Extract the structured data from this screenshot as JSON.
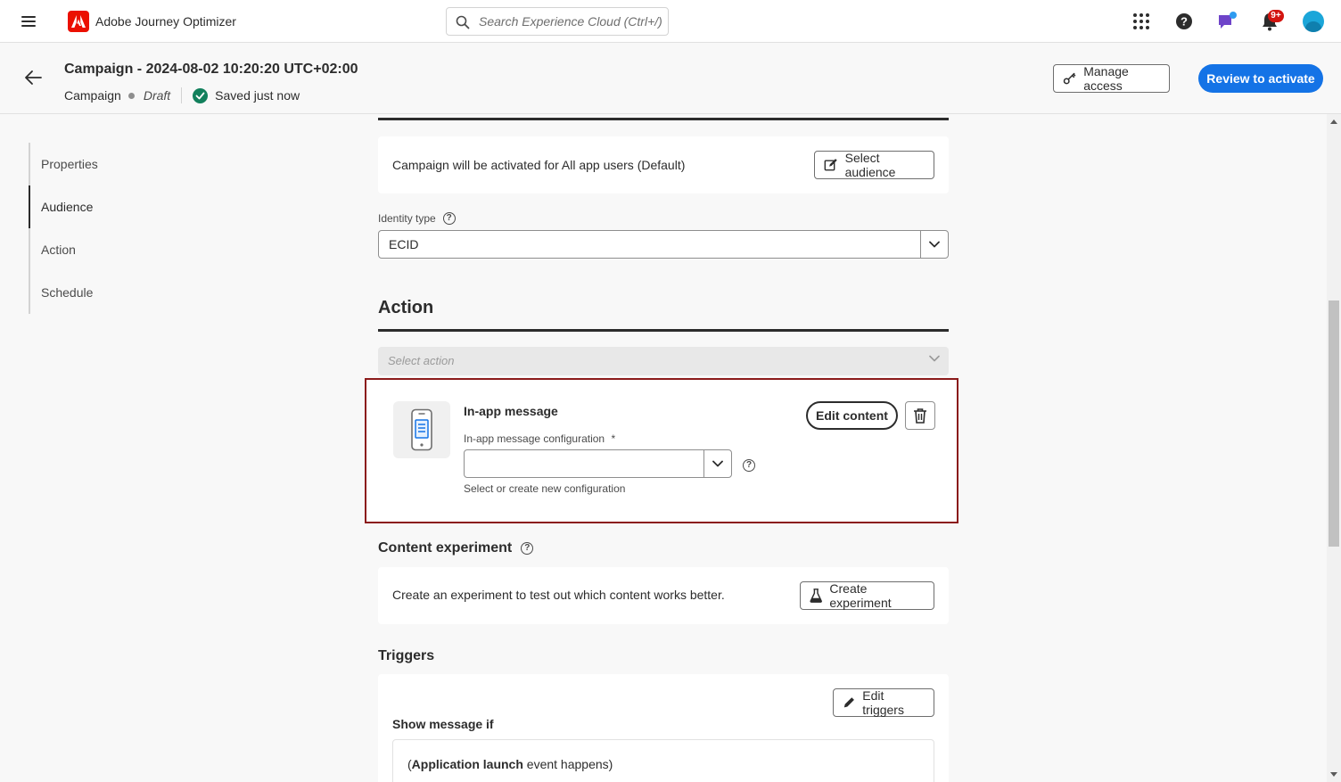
{
  "app": {
    "name": "Adobe Journey Optimizer",
    "brand_color": "#eb1000",
    "search_placeholder": "Search Experience Cloud (Ctrl+/)",
    "notification_badge": "9+"
  },
  "header": {
    "title": "Campaign - 2024-08-02 10:20:20 UTC+02:00",
    "type": "Campaign",
    "status": "Draft",
    "save_status": "Saved just now",
    "manage_access_label": "Manage access",
    "review_label": "Review to activate",
    "accent_color": "#1473e6"
  },
  "nav": {
    "items": [
      {
        "label": "Properties"
      },
      {
        "label": "Audience"
      },
      {
        "label": "Action"
      },
      {
        "label": "Schedule"
      }
    ],
    "active": "Audience"
  },
  "audience": {
    "description": "Campaign will be activated for All app users (Default)",
    "select_audience_label": "Select audience",
    "identity_type_label": "Identity type",
    "identity_type_value": "ECID"
  },
  "action": {
    "title": "Action",
    "select_placeholder": "Select action",
    "message": {
      "title": "In-app message",
      "config_label": "In-app message configuration",
      "required_mark": "*",
      "config_value": "",
      "config_help": "Select or create new configuration",
      "edit_label": "Edit content"
    }
  },
  "experiment": {
    "title": "Content experiment",
    "description": "Create an experiment to test out which content works better.",
    "button_label": "Create experiment"
  },
  "triggers": {
    "title": "Triggers",
    "edit_label": "Edit triggers",
    "show_if_label": "Show message if",
    "open_paren": "(",
    "event_name": "Application launch",
    "event_suffix": " event happens)"
  }
}
